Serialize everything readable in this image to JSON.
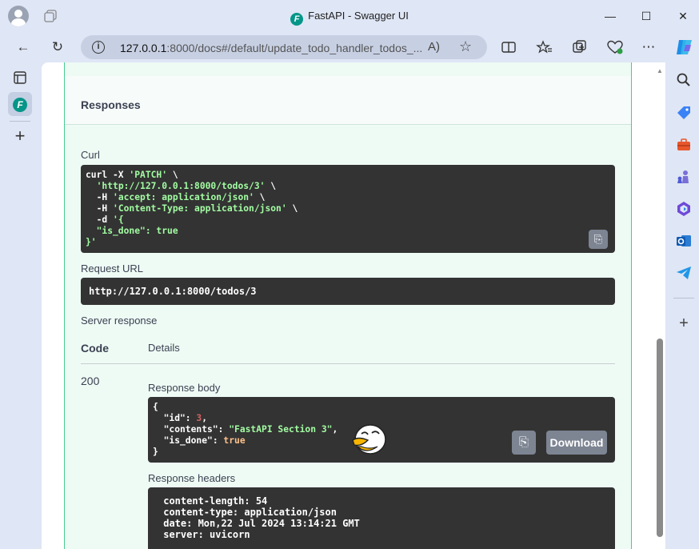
{
  "window": {
    "title": "FastAPI - Swagger UI",
    "favicon_letter": "F",
    "minimize_glyph": "—",
    "maximize_glyph": "☐",
    "close_glyph": "✕"
  },
  "nav": {
    "url_host": "127.0.0.1",
    "url_rest": ":8000/docs#/default/update_todo_handler_todos_...",
    "info_glyph": "i",
    "read_aloud_glyph": "A)",
    "favorite_glyph": "☆"
  },
  "responses": {
    "heading": "Responses",
    "curl_label": "Curl",
    "curl_lines": [
      {
        "plain": "curl -X ",
        "str": "'PATCH'",
        "tail": " \\"
      },
      {
        "plain": "  ",
        "str": "'http://127.0.0.1:8000/todos/3'",
        "tail": " \\"
      },
      {
        "plain": "  -H ",
        "str": "'accept: application/json'",
        "tail": " \\"
      },
      {
        "plain": "  -H ",
        "str": "'Content-Type: application/json'",
        "tail": " \\"
      },
      {
        "plain": "  -d ",
        "str": "'{",
        "tail": ""
      },
      {
        "plain": "",
        "str": "  \"is_done\": true",
        "tail": ""
      },
      {
        "plain": "",
        "str": "}'",
        "tail": ""
      }
    ],
    "request_url_label": "Request URL",
    "request_url": "http://127.0.0.1:8000/todos/3",
    "server_response_label": "Server response",
    "code_header": "Code",
    "details_header": "Details",
    "status_code": "200",
    "response_body_label": "Response body",
    "response_body": {
      "open": "{",
      "id_key": "  \"id\": ",
      "id_val": "3",
      "contents_key": "  \"contents\": ",
      "contents_val": "\"FastAPI Section 3\"",
      "is_done_key": "  \"is_done\": ",
      "is_done_val": "true",
      "close": "}"
    },
    "download_label": "Download",
    "response_headers_label": "Response headers",
    "response_headers": [
      " content-length: 54",
      " content-type: application/json",
      " date: Mon,22 Jul 2024 13:14:21 GMT",
      " server: uvicorn"
    ]
  },
  "colors": {
    "accent_patch": "#49cc90",
    "code_bg": "#333333",
    "string": "#a2fca2"
  }
}
